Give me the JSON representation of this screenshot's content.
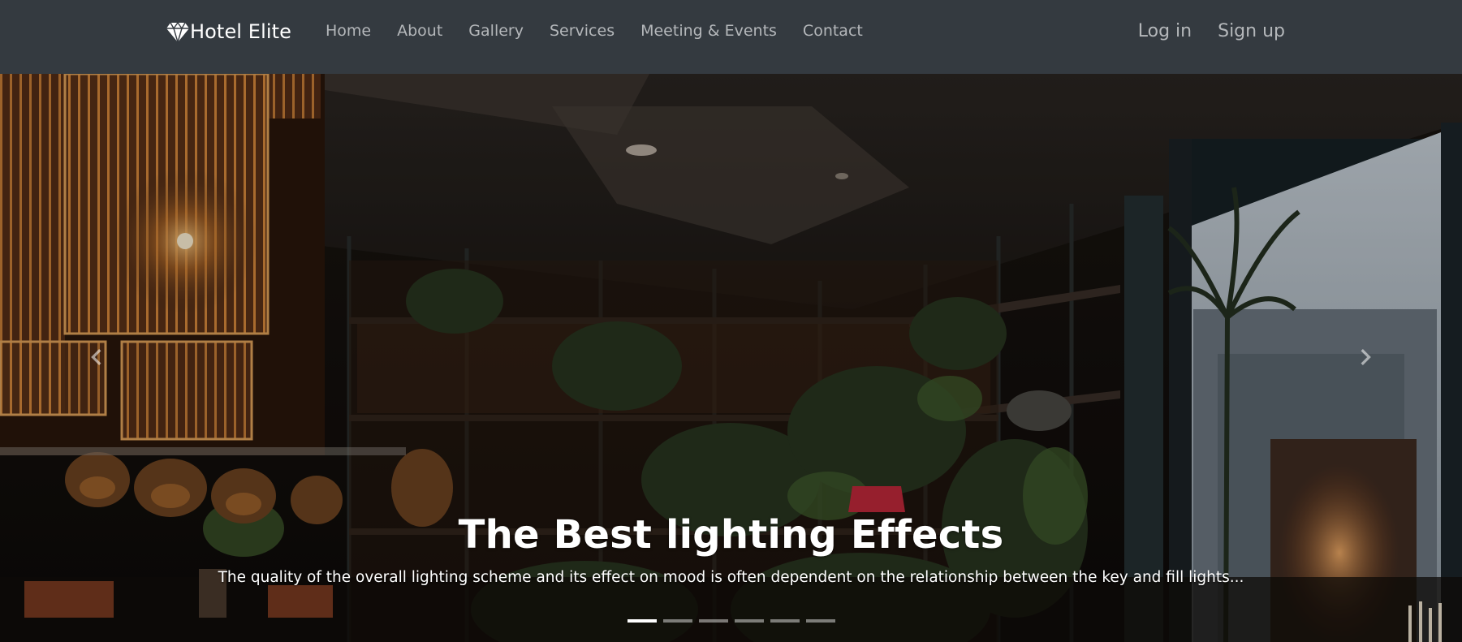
{
  "navbar": {
    "brand": "Hotel Elite",
    "brand_icon": "diamond-icon",
    "links": [
      "Home",
      "About",
      "Gallery",
      "Services",
      "Meeting & Events",
      "Contact"
    ],
    "login": "Log in",
    "signup": "Sign up",
    "background_color": "#343a40"
  },
  "carousel": {
    "slide_count": 6,
    "active_index": 0,
    "caption_title": "The Best lighting Effects",
    "caption_text": "The quality of the overall lighting scheme and its effect on mood is often dependent on the relationship between the key and fill lights...",
    "prev_icon": "chevron-left-icon",
    "next_icon": "chevron-right-icon"
  }
}
